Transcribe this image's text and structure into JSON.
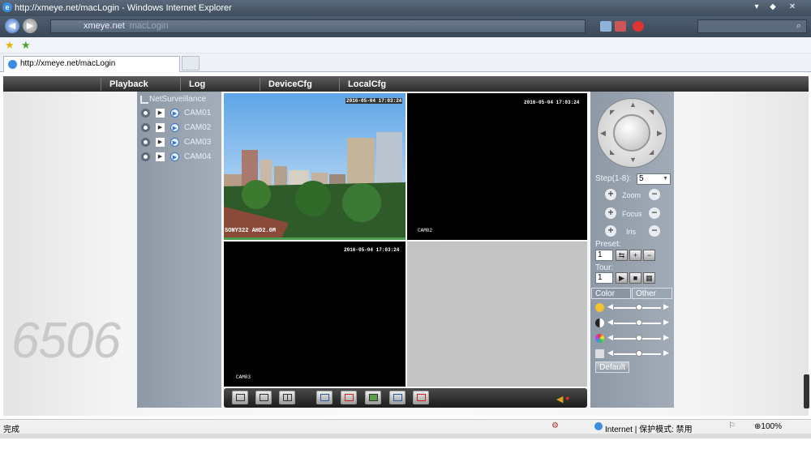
{
  "window": {
    "title": "http://xmeye.net/macLogin - Windows Internet Explorer",
    "ie_icon": "e"
  },
  "address_bar": {
    "url": "xmeye.net",
    "blurred_text": "macLogin"
  },
  "tab": {
    "label": "http://xmeye.net/macLogin"
  },
  "menu": {
    "items": [
      "Playback",
      "Log",
      "DeviceCfg",
      "LocalCfg"
    ]
  },
  "watermark": "6506",
  "left_panel": {
    "title": "NetSurveillance",
    "cameras": [
      "CAM01",
      "CAM02",
      "CAM03",
      "CAM04"
    ]
  },
  "video": {
    "ch1": {
      "timestamp": "2016-05-04 17:03:24",
      "caption": "SONY322 AHD2.0M"
    },
    "ch2": {
      "timestamp": "2016-05-04 17:03:24",
      "caption": "CAM02"
    },
    "ch3": {
      "timestamp": "2016-05-04 17:03:24",
      "caption": "CAM03"
    }
  },
  "ptz": {
    "step_label": "Step(1-8):",
    "step_value": "5",
    "zoom_label": "Zoom",
    "focus_label": "Focus",
    "iris_label": "Iris",
    "preset_label": "Preset:",
    "preset_value": "1",
    "tour_label": "Tour:",
    "tour_value": "1",
    "tabs": [
      "Color",
      "Other"
    ],
    "default_button": "Default",
    "plus": "+",
    "minus": "−"
  },
  "status": {
    "done": "完成",
    "zone": "Internet | 保护模式: 禁用",
    "zoom": "100%"
  }
}
